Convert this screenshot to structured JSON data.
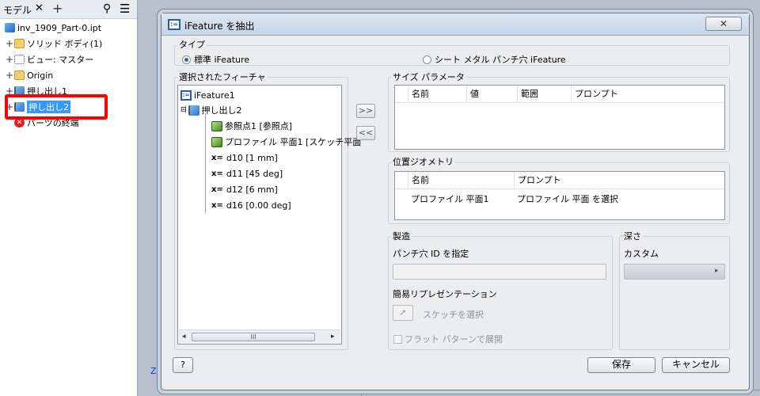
{
  "browser": {
    "tab_label": "モデル",
    "close_glyph": "✕",
    "add_glyph": "+",
    "search_glyph": "⚲",
    "menu_glyph": "☰",
    "items": [
      {
        "label": "inv_1909_Part-0.ipt",
        "icon": "part-icon"
      },
      {
        "label": "ソリッド ボディ(1)",
        "icon": "folder-icon"
      },
      {
        "label": "ビュー: マスター",
        "icon": "view-icon"
      },
      {
        "label": "Origin",
        "icon": "folder-icon"
      },
      {
        "label": "押し出し1",
        "icon": "extrusion-icon"
      },
      {
        "label": "押し出し2",
        "icon": "extrusion-icon",
        "selected": true
      },
      {
        "label": "パーツの終端",
        "icon": "end-of-part-icon"
      }
    ]
  },
  "viewport": {
    "axis_label": "Z"
  },
  "dialog": {
    "title": "iFeature を抽出",
    "close_glyph": "✕",
    "type": {
      "label": "タイプ",
      "option_standard": "標準 iFeature",
      "option_sheetmetal": "シート メタル パンチ穴 iFeature",
      "selected": "standard"
    },
    "selected_features": {
      "label": "選択されたフィーチャ",
      "root": "iFeature1",
      "feature": "押し出し2",
      "children": [
        "参照点1 [参照点]",
        "プロファイル 平面1 [スケッチ平面"
      ],
      "param_prefix": "x=",
      "params": [
        "d10 [1 mm]",
        "d11 [45 deg]",
        "d12 [6 mm]",
        "d16 [0.00 deg]"
      ],
      "scroll_left": "◂",
      "scroll_right": "▸",
      "scroll_thumb": "III"
    },
    "move_right": ">>",
    "move_left": "<<",
    "size_params": {
      "label": "サイズ パラメータ",
      "columns": [
        "名前",
        "値",
        "範囲",
        "プロンプト"
      ]
    },
    "position_geometry": {
      "label": "位置ジオメトリ",
      "columns": [
        "名前",
        "プロンプト"
      ],
      "rows": [
        {
          "name": "プロファイル 平面1",
          "prompt": "プロファイル 平面 を選択"
        }
      ]
    },
    "manufacture": {
      "label": "製造",
      "punch_id_label": "パンチ穴 ID を指定",
      "simple_rep_label": "簡易リプレゼンテーション",
      "select_sketch_label": "スケッチを選択",
      "flat_pattern_label": "フラット パターンで展開"
    },
    "depth": {
      "label": "深さ",
      "value": "カスタム",
      "dropdown_glyph": "▸"
    },
    "help_glyph": "?",
    "save_label": "保存",
    "cancel_label": "キャンセル"
  }
}
